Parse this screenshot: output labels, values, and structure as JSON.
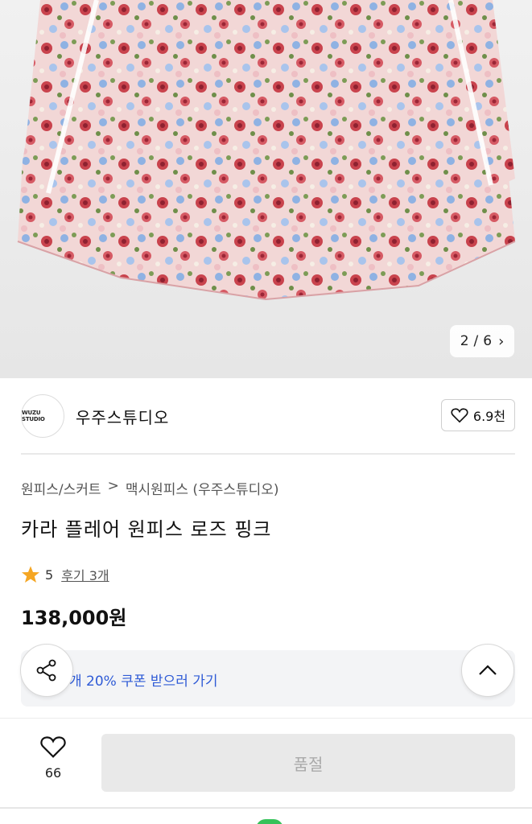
{
  "gallery": {
    "current": "2",
    "separator": "/",
    "total": "6"
  },
  "brand": {
    "logo_text": "WUZU STUDIO",
    "name": "우주스튜디오",
    "likes": "6.9천"
  },
  "breadcrumb": {
    "category": "원피스/스커트",
    "separator": ">",
    "subcategory": "맥시원피스 (우주스튜디오)"
  },
  "product": {
    "title": "카라 플레어 원피스 로즈 핑크",
    "rating": "5",
    "reviews": "후기 3개",
    "price": "138,000원"
  },
  "coupon": {
    "text": "개 20% 쿠폰 받으러 가기"
  },
  "bottom": {
    "wish_count": "66",
    "buy_label": "품절"
  },
  "colors": {
    "accent_blue": "#2f5bd6",
    "star": "#f5a623",
    "soldout_bg": "#e9e9e9"
  }
}
